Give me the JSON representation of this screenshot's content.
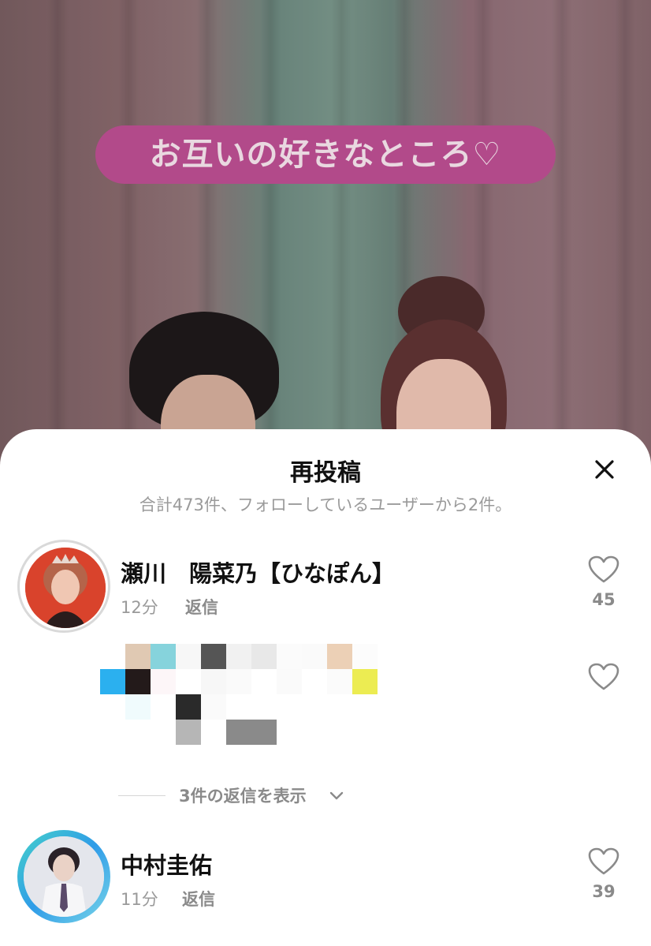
{
  "video": {
    "caption": "お互いの好きなところ♡"
  },
  "sheet": {
    "title": "再投稿",
    "subtitle": "合計473件、フォローしているユーザーから2件。"
  },
  "comments": [
    {
      "name": "瀬川　陽菜乃【ひなぽん】",
      "time": "12分",
      "reply_label": "返信",
      "likes": "45"
    },
    {
      "name": "中村圭佑",
      "time": "11分",
      "reply_label": "返信",
      "likes": "39"
    }
  ],
  "replies_toggle": {
    "label": "3件の返信を表示"
  },
  "icons": {
    "close": "close-icon",
    "like": "heart-outline-icon",
    "expand": "chevron-down-icon"
  },
  "colors": {
    "caption_bg": "#b24a8a",
    "muted_text": "#9a9a9a",
    "sheet_bg": "#ffffff"
  }
}
